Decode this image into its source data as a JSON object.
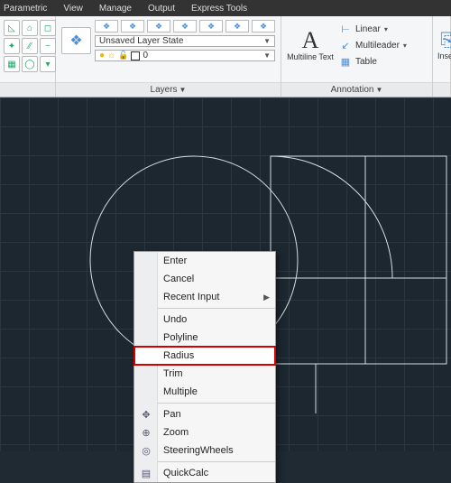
{
  "menubar": {
    "items": [
      "Parametric",
      "View",
      "Manage",
      "Output",
      "Express Tools"
    ]
  },
  "ribbon": {
    "layers": {
      "label": "Layers",
      "state_selector": "Unsaved Layer State",
      "current_layer": "0"
    },
    "annotation": {
      "label": "Annotation",
      "multiline": "Multiline Text",
      "linear": "Linear",
      "multileader": "Multileader",
      "table": "Table"
    },
    "insert": {
      "label": "Insert"
    }
  },
  "context_menu": {
    "enter": "Enter",
    "cancel": "Cancel",
    "recent": "Recent Input",
    "undo": "Undo",
    "polyline": "Polyline",
    "radius": "Radius",
    "trim": "Trim",
    "multiple": "Multiple",
    "pan": "Pan",
    "zoom": "Zoom",
    "steering": "SteeringWheels",
    "quickcalc": "QuickCalc"
  }
}
